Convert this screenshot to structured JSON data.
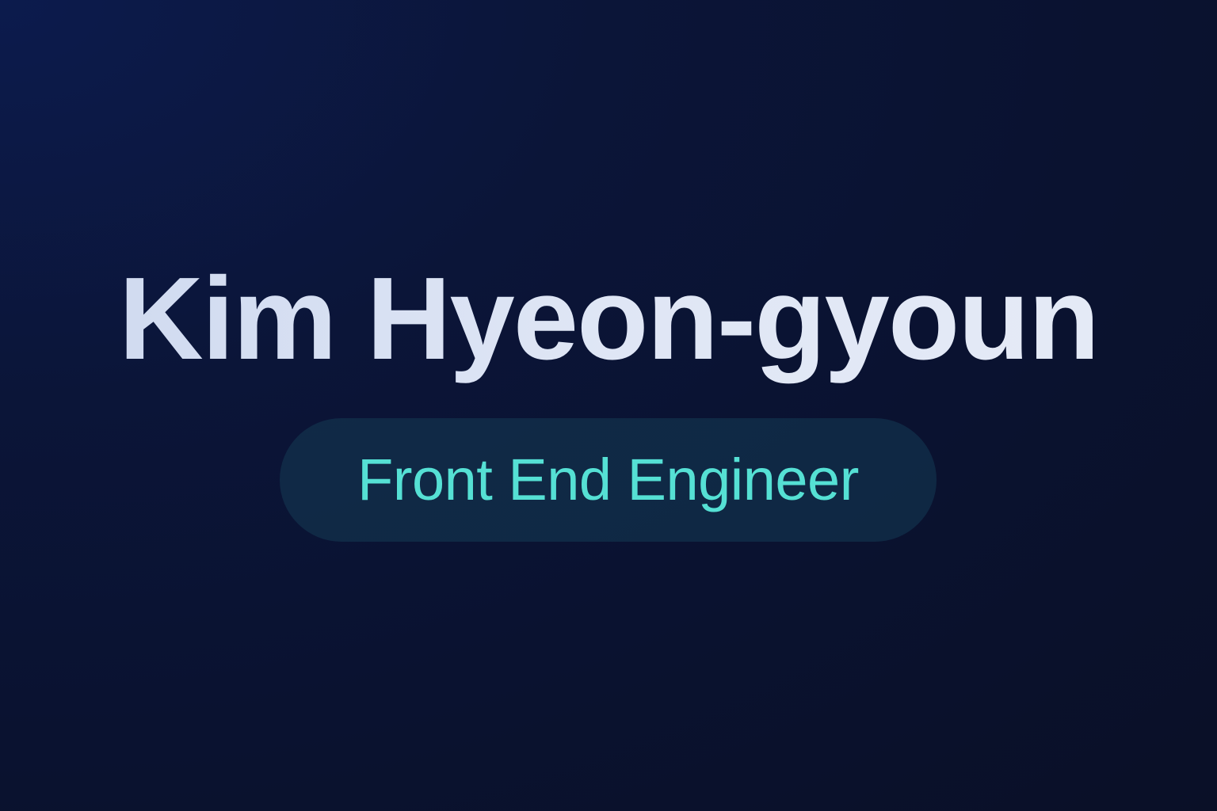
{
  "profile": {
    "name": "Kim Hyeon-gyoun",
    "role": "Front End Engineer"
  },
  "colors": {
    "background": "#0a1230",
    "name_text": "#dbe3f4",
    "role_text": "#55e0d4",
    "pill_background": "#143750"
  }
}
